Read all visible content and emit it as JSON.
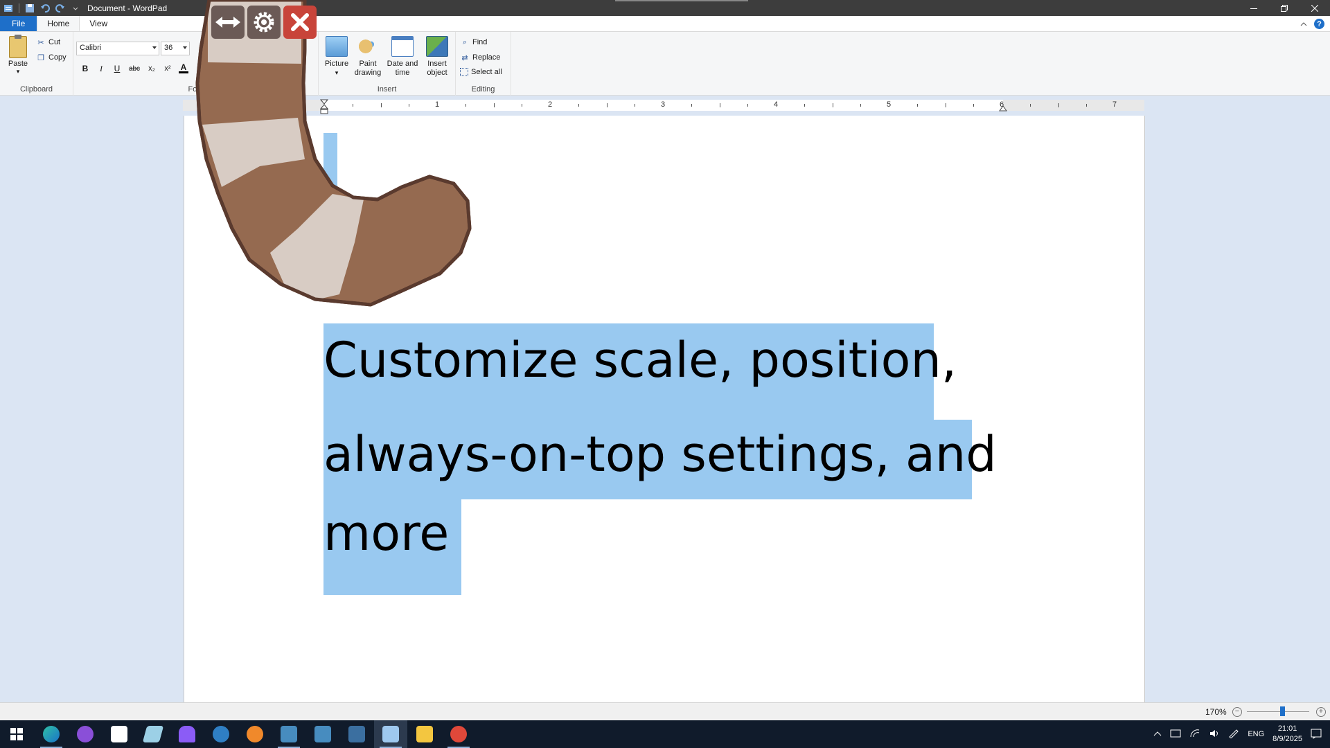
{
  "window": {
    "title": "Document - WordPad"
  },
  "tabs": [
    {
      "label": "File"
    },
    {
      "label": "Home"
    },
    {
      "label": "View"
    }
  ],
  "ribbon": {
    "clipboard": {
      "paste": "Paste",
      "cut": "Cut",
      "copy": "Copy",
      "group_label": "Clipboard"
    },
    "font": {
      "name": "Calibri",
      "size": "36",
      "group_label": "Font",
      "bold": "B",
      "italic": "I",
      "underline": "U",
      "strikethrough": "abc",
      "subscript": "x₂",
      "superscript": "x²",
      "color_letter": "A"
    },
    "insert": {
      "picture": "Picture",
      "paint_drawing": "Paint drawing",
      "date_time": "Date and time",
      "insert_object": "Insert object",
      "group_label": "Insert"
    },
    "editing": {
      "find": "Find",
      "replace": "Replace",
      "select_all": "Select all",
      "group_label": "Editing"
    }
  },
  "ruler": {
    "numbers": [
      "1",
      "2",
      "3",
      "4",
      "5",
      "6",
      "7"
    ]
  },
  "document": {
    "lines": [
      "Customize scale, position,",
      "always-on-top settings, and",
      "more"
    ],
    "selected": true
  },
  "statusbar": {
    "zoom": "170%"
  },
  "taskbar": {
    "language": "ENG",
    "time": "21:01",
    "date": "8/9/2025",
    "apps": [
      "edge-icon",
      "github-icon",
      "notes-icon",
      "pen-icon",
      "mage-icon",
      "steam-icon",
      "blender-icon",
      "godot-icon",
      "godot-icon-2",
      "godot-icon-3",
      "wordpad-icon",
      "file-explorer-icon",
      "app-icon"
    ]
  },
  "colors": {
    "accent": "#1e6fc9",
    "selection": "#99c9f0",
    "tail_dark": "#956a50",
    "tail_light": "#d8ccc4",
    "tail_outline": "#5a3a2e",
    "close_red": "#c8443a"
  }
}
